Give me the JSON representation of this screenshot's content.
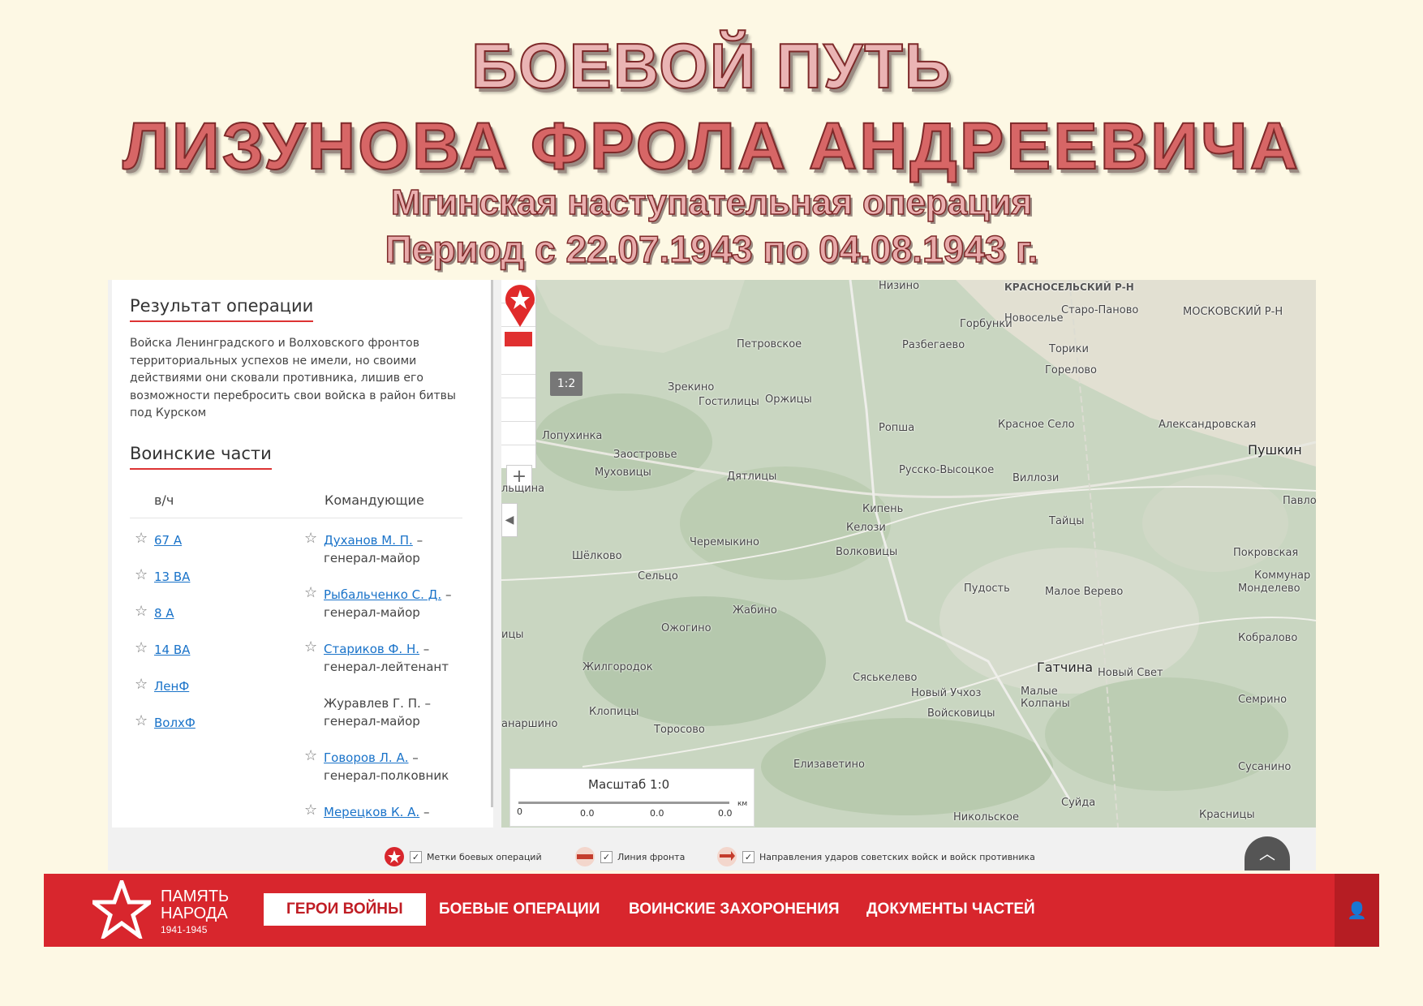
{
  "title": {
    "line1": "БОЕВОЙ ПУТЬ",
    "line2": "ЛИЗУНОВА ФРОЛА АНДРЕЕВИЧА",
    "operation": "Мгинская наступательная операция",
    "period": "Период с 22.07.1943 по 04.08.1943 г."
  },
  "panel": {
    "result_heading": "Результат операции",
    "result_text": "Войска Ленинградского и Волховского фронтов территориальных успехов не имели, но своими действиями они сковали противника, лишив его возможности перебросить свои войска в район битвы под Курском",
    "units_heading": "Воинские части",
    "col_unit": "в/ч",
    "col_commanders": "Командующие",
    "units": [
      "67 А",
      "13 ВА",
      "8 А",
      "14 ВА",
      "ЛенФ",
      "ВолхФ"
    ],
    "commanders": [
      {
        "name": "Духанов М. П.",
        "rank": "генерал-майор",
        "link": true
      },
      {
        "name": "Рыбальченко С. Д.",
        "rank": "генерал-майор",
        "link": true
      },
      {
        "name": "Стариков Ф. Н.",
        "rank": "генерал-лейтенант",
        "link": true
      },
      {
        "name": "Журавлев Г. П.",
        "rank": "генерал-майор",
        "link": false
      },
      {
        "name": "Говоров Л. А.",
        "rank": "генерал-полковник",
        "link": true
      },
      {
        "name": "Мерецков К. А.",
        "rank": "",
        "link": true
      }
    ]
  },
  "map": {
    "ratio_label": "1:2",
    "scale_label": "Масштаб 1:0",
    "scale_ticks": [
      "0",
      "0.0",
      "0.0",
      "0.0",
      "км"
    ],
    "places": {
      "nizino": "Низино",
      "krasnoselsky": "КРАСНОСЕЛЬСКИЙ Р-Н",
      "moskovsky": "МОСКОВСКИЙ Р-Н",
      "staro_panovo": "Старо-Паново",
      "novoselye": "Новоселье",
      "gorbunki": "Горбунки",
      "petrovskoe": "Петровское",
      "razbegaevo": "Разбегаево",
      "toriki": "Торики",
      "gorelovo": "Горелово",
      "zrekino": "Зрекино",
      "gostilitsy": "Гостилицы",
      "orzhitsy": "Оржицы",
      "ropsha": "Ропша",
      "krasnoe_selo": "Красное Село",
      "aleksandrovskaya": "Александровская",
      "pushkin": "Пушкин",
      "lopukhinka": "Лопухинка",
      "zaostrovye": "Заостровье",
      "mukhovitsy": "Муховицы",
      "dyatlitsy": "Дятлицы",
      "russko_vysotskoe": "Русско-Высоцкое",
      "villozi": "Виллози",
      "kipen": "Кипень",
      "kelozi": "Келози",
      "taitsy": "Тайцы",
      "pavlovsk": "Павлов",
      "shelkovo": "Шёлково",
      "cheremykino": "Черемыкино",
      "volkovitsy": "Волковицы",
      "seltso": "Сельцо",
      "pokrovskaya": "Покровская",
      "kommunar": "Коммунар",
      "pudost": "Пудость",
      "maloe_verevo": "Малое Верево",
      "mondelevo": "Монделево",
      "zhabino": "Жабино",
      "ozhogino": "Ожогино",
      "kobralovo": "Кобралово",
      "zhilgorodok": "Жилгородок",
      "syaskelevo": "Сяськелево",
      "gatchina": "Гатчина",
      "novy_svet": "Новый Свет",
      "novy_uchkhoz": "Новый Учхоз",
      "malye_kolpany": "Малые Колпаны",
      "semrino": "Семрино",
      "klopitsy": "Клопицы",
      "voiskovitsy": "Войсковицы",
      "torosovo": "Торосово",
      "elizavetino": "Елизаветино",
      "susanino": "Сусанино",
      "suida": "Суйда",
      "nikolskoe": "Никольское",
      "krasnitsy": "Красницы",
      "anarshino": "анаршино",
      "shchina": "льщина",
      "ditsy": "ицы",
      "itsy": "ицы"
    }
  },
  "legend": {
    "markers": "Метки боевых операций",
    "frontline": "Линия фронта",
    "directions": "Направления ударов советских войск и войск противника"
  },
  "navbar": {
    "logo_line1": "ПАМЯТЬ",
    "logo_line2": "НАРОДА",
    "logo_years": "1941-1945",
    "items": [
      "ГЕРОИ ВОЙНЫ",
      "БОЕВЫЕ ОПЕРАЦИИ",
      "ВОИНСКИЕ ЗАХОРОНЕНИЯ",
      "ДОКУМЕНТЫ ЧАСТЕЙ"
    ]
  },
  "colors": {
    "accent_red": "#d8262d",
    "link_blue": "#1a73c9",
    "page_bg": "#fdf8e4"
  }
}
